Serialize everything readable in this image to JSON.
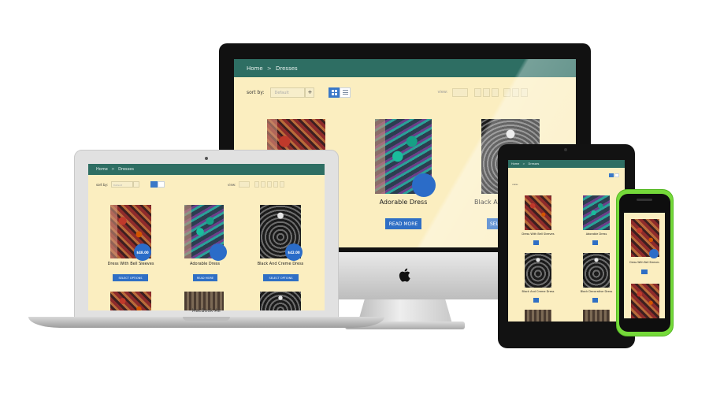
{
  "devices": {
    "imac_label": "",
    "macbook_label": "MacBook Air"
  },
  "site": {
    "breadcrumb": {
      "home": "Home",
      "separator": ">",
      "current": "Dresses"
    },
    "sort_label": "sort by:",
    "sort_value": "Default",
    "view_label": "view:",
    "colors": {
      "header": "#2e6e63",
      "background": "#fbeec0",
      "accent": "#2f6fc5"
    }
  },
  "imac": {
    "products": [
      {
        "name": "",
        "price": "",
        "button": ""
      },
      {
        "name": "Adorable Dress",
        "price": "",
        "button": "READ MORE"
      },
      {
        "name": "Black A",
        "price": "",
        "button": "SELE"
      }
    ]
  },
  "macbook": {
    "products": [
      {
        "name": "Dress With Bell Sleeves",
        "price": "$48.00",
        "button": "SELECT OPTIONS"
      },
      {
        "name": "Adorable Dress",
        "price": "",
        "button": "READ MORE"
      },
      {
        "name": "Black And Creme Dress",
        "price": "$42.00",
        "button": "SELECT OPTIONS"
      }
    ]
  },
  "ipad": {
    "products": [
      {
        "name": "Dress With Bell Sleeves"
      },
      {
        "name": "Adorable Dress"
      },
      {
        "name": "Black And Creme Dress"
      },
      {
        "name": "Black Decorative Dress"
      }
    ]
  },
  "phone": {
    "products": [
      {
        "name": "Dress With Bell Sleeves"
      }
    ]
  }
}
